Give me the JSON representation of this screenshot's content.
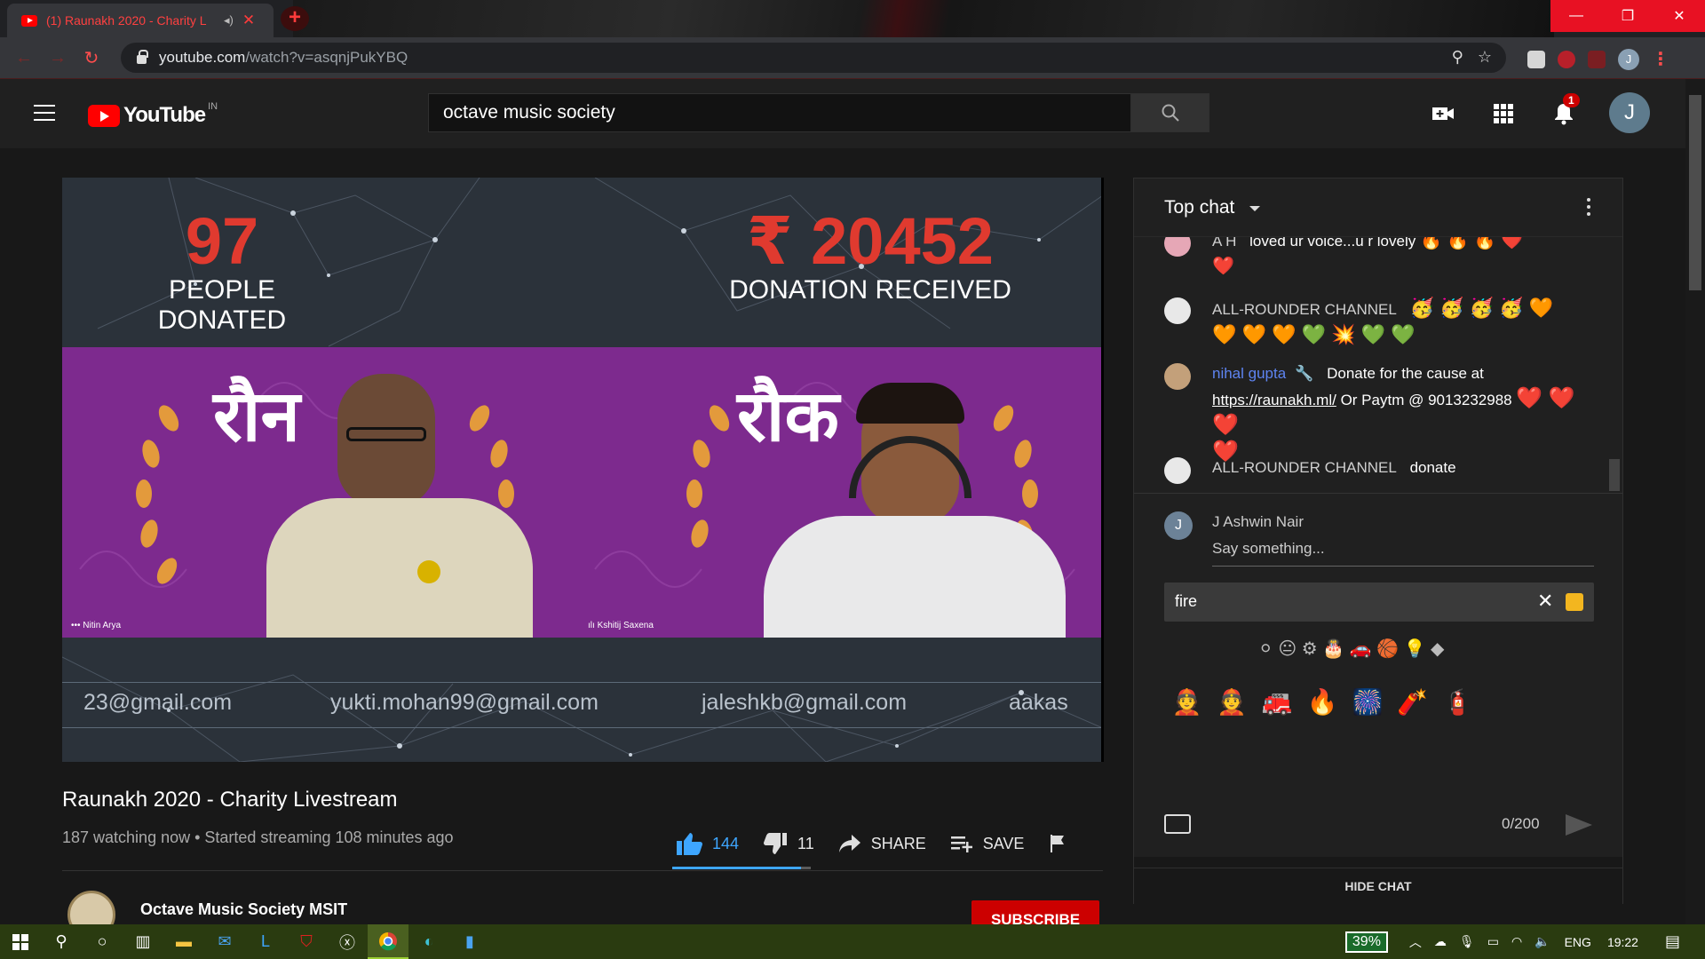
{
  "browser": {
    "tab_title": "(1) Raunakh 2020 - Charity L",
    "new_tab": "+",
    "url_host": "youtube.com",
    "url_path": "/watch?v=asqnjPukYBQ",
    "profile_initial": "J"
  },
  "header": {
    "logo_text": "YouTube",
    "country_code": "IN",
    "search_value": "octave music society",
    "notification_count": "1",
    "avatar_initial": "J"
  },
  "video": {
    "donors_count": "97",
    "donors_label": "PEOPLE DONATED",
    "amount": "₹ 20452",
    "amount_label": "DONATION RECEIVED",
    "banner_left": "रौन",
    "banner_right": "रौक",
    "speaker_left": "Nitin Arya",
    "speaker_right": "Kshitij Saxena",
    "emails": [
      "23@gmail.com",
      "yukti.mohan99@gmail.com",
      "jaleshkb@gmail.com",
      "aakas"
    ]
  },
  "info": {
    "title": "Raunakh 2020 - Charity Livestream",
    "meta": "187 watching now • Started streaming 108 minutes ago",
    "likes": "144",
    "dislikes": "11",
    "like_ratio": 0.93,
    "share": "SHARE",
    "save": "SAVE",
    "channel": "Octave Music Society MSIT",
    "subscribe": "SUBSCRIBE"
  },
  "chat": {
    "header": "Top chat",
    "messages": [
      {
        "author": "A H",
        "text": "loved ur voice...u r lovely",
        "emoji": "🔥 🔥 🔥 ❤️",
        "emoji2": "❤️"
      },
      {
        "author": "ALL-ROUNDER CHANNEL",
        "text": "",
        "emoji": "🥳 🥳 🥳 🥳 🧡",
        "emoji2": "🧡 🧡 🧡 💚 💥 💚 💚"
      },
      {
        "author": "nihal gupta",
        "text": "Donate for the cause at",
        "link": "https://raunakh.ml/",
        "text2": "Or Paytm @ 9013232988",
        "emoji": "❤️ ❤️ ❤️",
        "emoji2": "❤️"
      },
      {
        "author": "ALL-ROUNDER CHANNEL",
        "text": "donate"
      }
    ],
    "me_name": "J Ashwin Nair",
    "me_initial": "J",
    "placeholder": "Say something...",
    "emoji_search": "fire",
    "category_icons": "⚪ 😐 ⚙ 🎂 🚗 🏀 💡 ◆",
    "results": [
      "👲",
      "👲",
      "🚒",
      "🔥",
      "🎆",
      "🧨",
      "🧯"
    ],
    "counter": "0/200",
    "hide_chat": "HIDE CHAT"
  },
  "taskbar": {
    "battery": "39%",
    "lang": "ENG",
    "time": "19:22"
  },
  "colors": {
    "accent_red": "#ff0000",
    "like_blue": "#3ea6ff",
    "stat_red": "#e03a2f",
    "band_purple": "#7d2a8e",
    "taskbar": "#2a3b10"
  }
}
